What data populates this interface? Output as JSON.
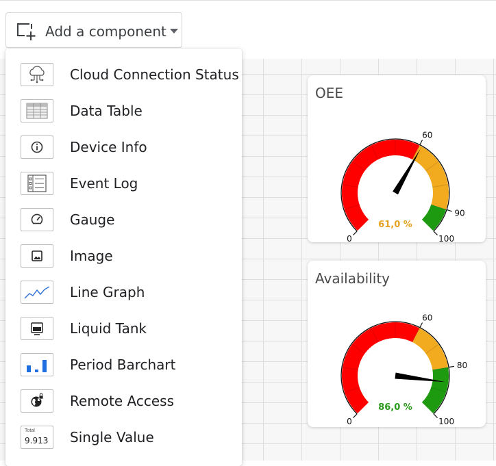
{
  "toolbar": {
    "add_component_label": "Add a component",
    "add_icon": "add-component-icon",
    "caret_icon": "caret-down-icon"
  },
  "menu": {
    "items": [
      {
        "label": "Cloud Connection Status",
        "icon": "cloud-connection-icon"
      },
      {
        "label": "Data Table",
        "icon": "data-table-icon"
      },
      {
        "label": "Device Info",
        "icon": "info-icon"
      },
      {
        "label": "Event Log",
        "icon": "event-log-icon"
      },
      {
        "label": "Gauge",
        "icon": "gauge-icon"
      },
      {
        "label": "Image",
        "icon": "image-icon"
      },
      {
        "label": "Line Graph",
        "icon": "line-graph-icon"
      },
      {
        "label": "Liquid Tank",
        "icon": "liquid-tank-icon"
      },
      {
        "label": "Period Barchart",
        "icon": "period-barchart-icon"
      },
      {
        "label": "Remote Access",
        "icon": "remote-access-icon"
      },
      {
        "label": "Single Value",
        "icon": "single-value-icon",
        "preview_caption": "Total",
        "preview_value": "9.913"
      }
    ]
  },
  "widgets": [
    {
      "title": "OEE",
      "value": 61.0,
      "value_label": "61,0 %",
      "value_color": "#e6a323",
      "min": 0,
      "max": 100,
      "bands": [
        {
          "from": 0,
          "to": 60,
          "color": "#ff0000"
        },
        {
          "from": 60,
          "to": 90,
          "color": "#f2aa1f"
        },
        {
          "from": 90,
          "to": 100,
          "color": "#1e9a10"
        }
      ],
      "tick_labels": [
        {
          "value": 0,
          "label": "0"
        },
        {
          "value": 60,
          "label": "60"
        },
        {
          "value": 90,
          "label": "90"
        },
        {
          "value": 100,
          "label": "100"
        }
      ]
    },
    {
      "title": "Availability",
      "value": 86.0,
      "value_label": "86,0 %",
      "value_color": "#2a9a1a",
      "min": 0,
      "max": 100,
      "bands": [
        {
          "from": 0,
          "to": 60,
          "color": "#ff0000"
        },
        {
          "from": 60,
          "to": 80,
          "color": "#f2aa1f"
        },
        {
          "from": 80,
          "to": 100,
          "color": "#1e9a10"
        }
      ],
      "tick_labels": [
        {
          "value": 0,
          "label": "0"
        },
        {
          "value": 60,
          "label": "60"
        },
        {
          "value": 80,
          "label": "80"
        },
        {
          "value": 100,
          "label": "100"
        }
      ]
    }
  ]
}
